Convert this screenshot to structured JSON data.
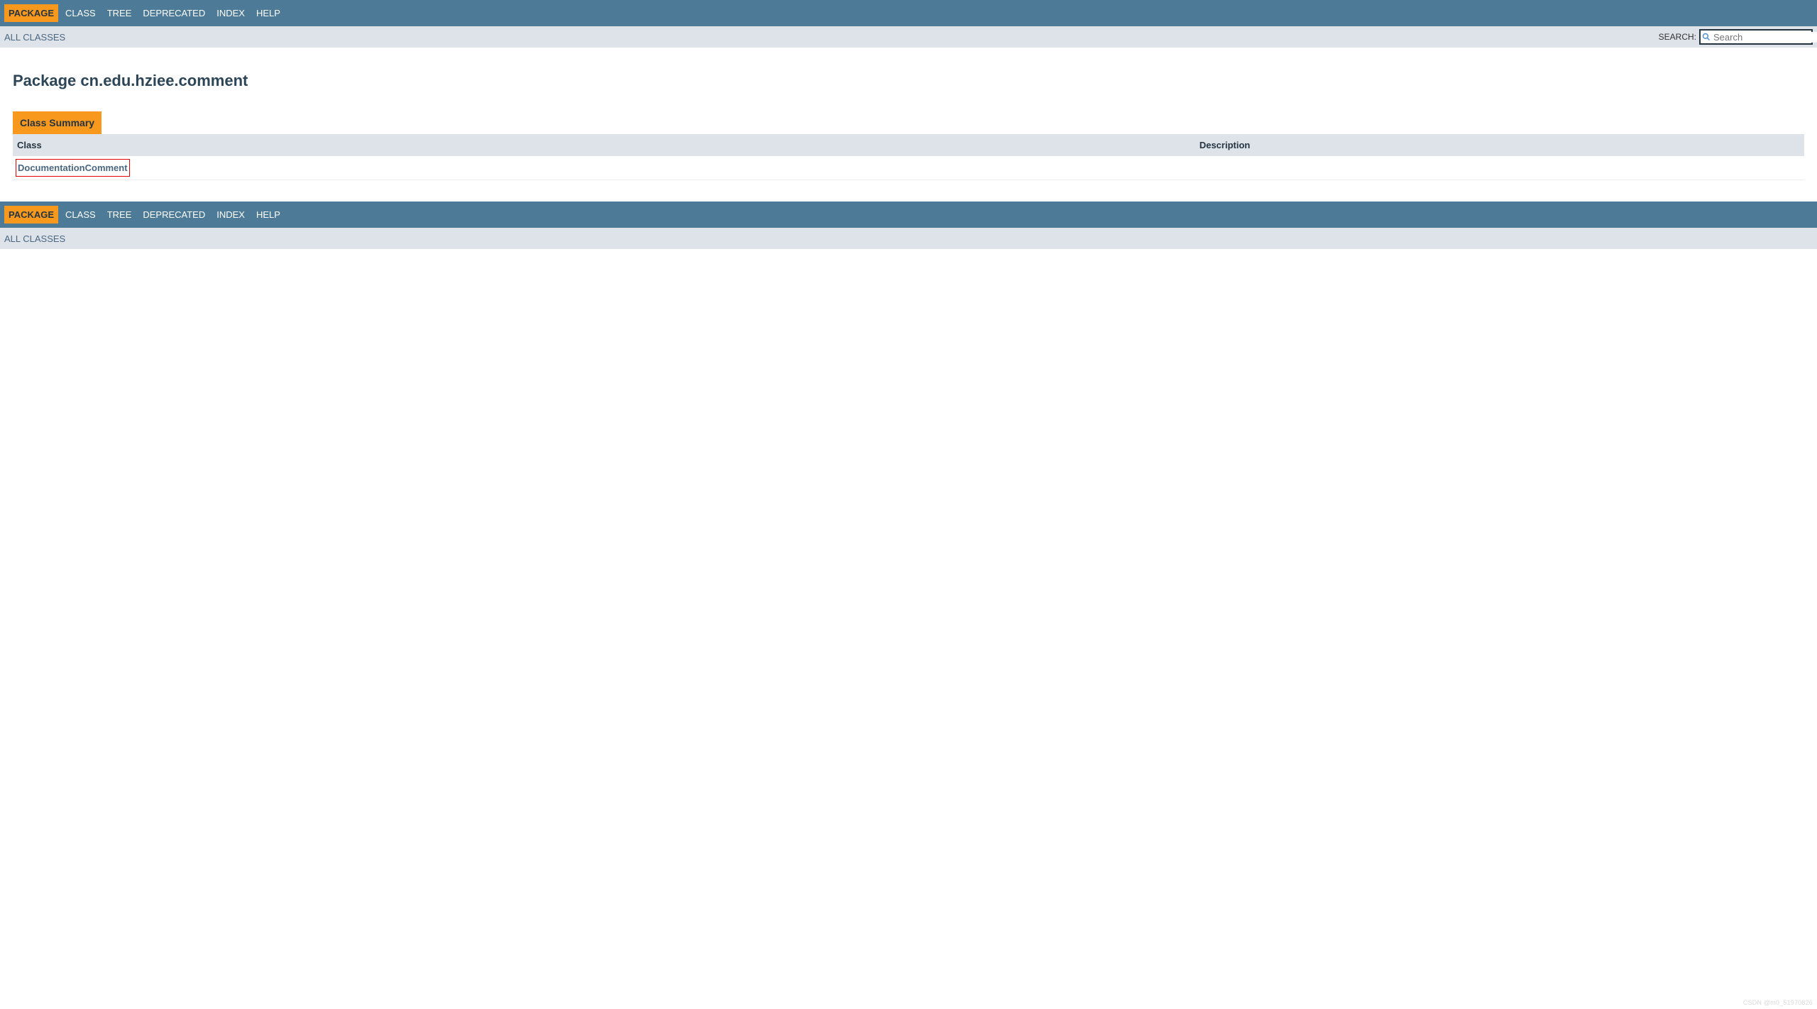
{
  "nav": {
    "items": [
      {
        "label": "PACKAGE",
        "active": true
      },
      {
        "label": "CLASS",
        "active": false
      },
      {
        "label": "TREE",
        "active": false
      },
      {
        "label": "DEPRECATED",
        "active": false
      },
      {
        "label": "INDEX",
        "active": false
      },
      {
        "label": "HELP",
        "active": false
      }
    ]
  },
  "subnav": {
    "all_classes": "ALL CLASSES",
    "search_label": "SEARCH:",
    "search_placeholder": "Search"
  },
  "page": {
    "title": "Package cn.edu.hziee.comment"
  },
  "summary": {
    "caption": "Class Summary",
    "headers": {
      "class": "Class",
      "description": "Description"
    },
    "rows": [
      {
        "class": "DocumentationComment",
        "description": ""
      }
    ]
  },
  "watermark": "CSDN @m0_51970826"
}
